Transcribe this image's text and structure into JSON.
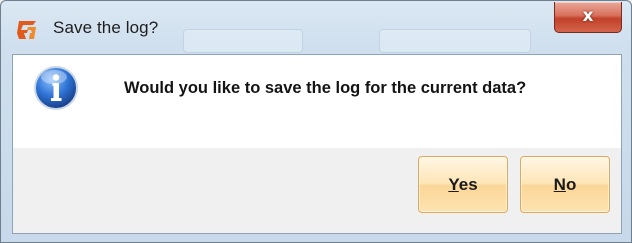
{
  "window": {
    "title": "Save the log?",
    "app_icon": "app-logo-icon",
    "close_glyph": "x"
  },
  "dialog": {
    "icon": "info-icon",
    "message": "Would you like to save the log for the current data?",
    "buttons": [
      {
        "label": "Yes",
        "mnemonic": "Y",
        "rest": "es"
      },
      {
        "label": "No",
        "mnemonic": "N",
        "rest": "o"
      }
    ]
  },
  "colors": {
    "button_border": "#e2a85a",
    "button_fill": "#fde6b8",
    "close_red": "#c2412a",
    "info_blue": "#1f5fbf"
  }
}
